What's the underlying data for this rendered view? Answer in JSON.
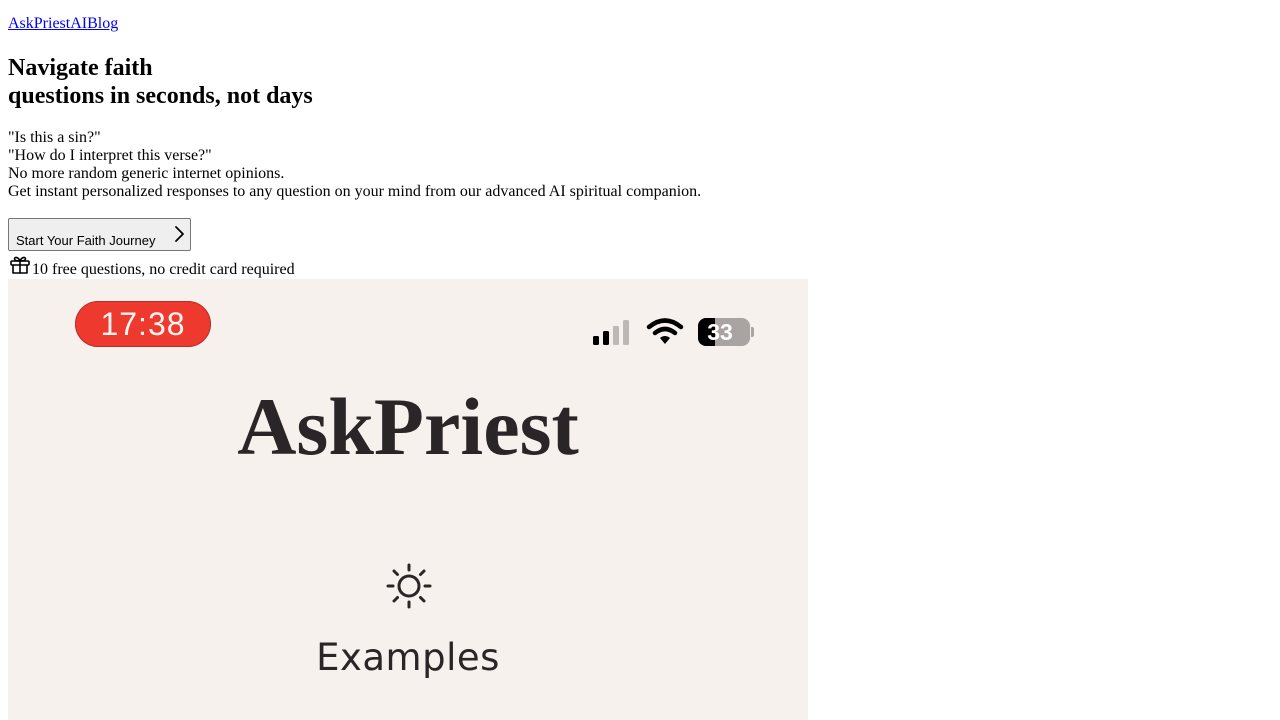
{
  "nav": {
    "home_link": "AskPriestAI",
    "blog_link": "Blog"
  },
  "hero": {
    "headline_line1": "Navigate faith",
    "headline_line2": "questions in seconds, not days",
    "quote1": "\"Is this a sin?\"",
    "quote2": "\"How do I interpret this verse?\"",
    "line3": "No more random generic internet opinions.",
    "line4": "Get instant personalized responses to any question on your mind from our advanced AI spiritual companion.",
    "cta_label": "Start Your Faith Journey",
    "cta_icon": "chevron-right-icon",
    "free_icon": "gift-icon",
    "free_text": "10 free questions, no credit card required"
  },
  "phone_mock": {
    "status_time": "17:38",
    "status_time_color": "#ee3a2e",
    "signal_icon": "cellular-signal-icon",
    "signal_bars_active": 2,
    "signal_bars_total": 4,
    "wifi_icon": "wifi-icon",
    "battery_text": "33",
    "battery_level": 0.33,
    "app_title": "AskPriest",
    "section_icon": "sun-icon",
    "section_label": "Examples",
    "background_color": "#f7f1ee"
  }
}
